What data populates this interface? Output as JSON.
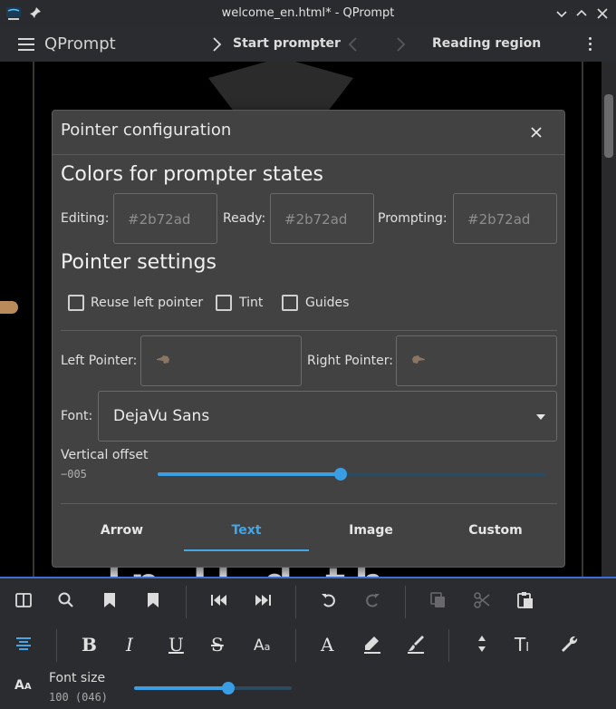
{
  "window": {
    "title": "welcome_en.html* - QPrompt"
  },
  "header": {
    "app_name": "QPrompt",
    "start_label": "Start prompter",
    "reading_label": "Reading region"
  },
  "canvas": {
    "background_text": "lp          ll        d     th"
  },
  "dialog": {
    "title": "Pointer configuration",
    "colors_section": "Colors for prompter states",
    "editing_label": "Editing:",
    "editing_value": "#2b72ad",
    "ready_label": "Ready:",
    "ready_value": "#2b72ad",
    "prompting_label": "Prompting:",
    "prompting_value": "#2b72ad",
    "pointer_section": "Pointer settings",
    "reuse_label": "Reuse left pointer",
    "tint_label": "Tint",
    "guides_label": "Guides",
    "left_pointer_label": "Left Pointer:",
    "right_pointer_label": "Right Pointer:",
    "font_label": "Font:",
    "font_value": "DejaVu Sans",
    "vertical_offset_label": "Vertical offset",
    "vertical_offset_value": "−005",
    "vertical_offset_fraction": 0.47,
    "tabs": [
      {
        "label": "Arrow",
        "active": false
      },
      {
        "label": "Text",
        "active": true
      },
      {
        "label": "Image",
        "active": false
      },
      {
        "label": "Custom",
        "active": false
      }
    ]
  },
  "toolbar": {
    "font_size_label": "Font size",
    "font_size_value": "100  (046)",
    "font_size_fraction": 0.6
  },
  "colors": {
    "accent": "#45a6e6",
    "slider": "#3a9ee4",
    "dialog_bg": "#424242",
    "toolbar_border": "#3c6fd6"
  }
}
